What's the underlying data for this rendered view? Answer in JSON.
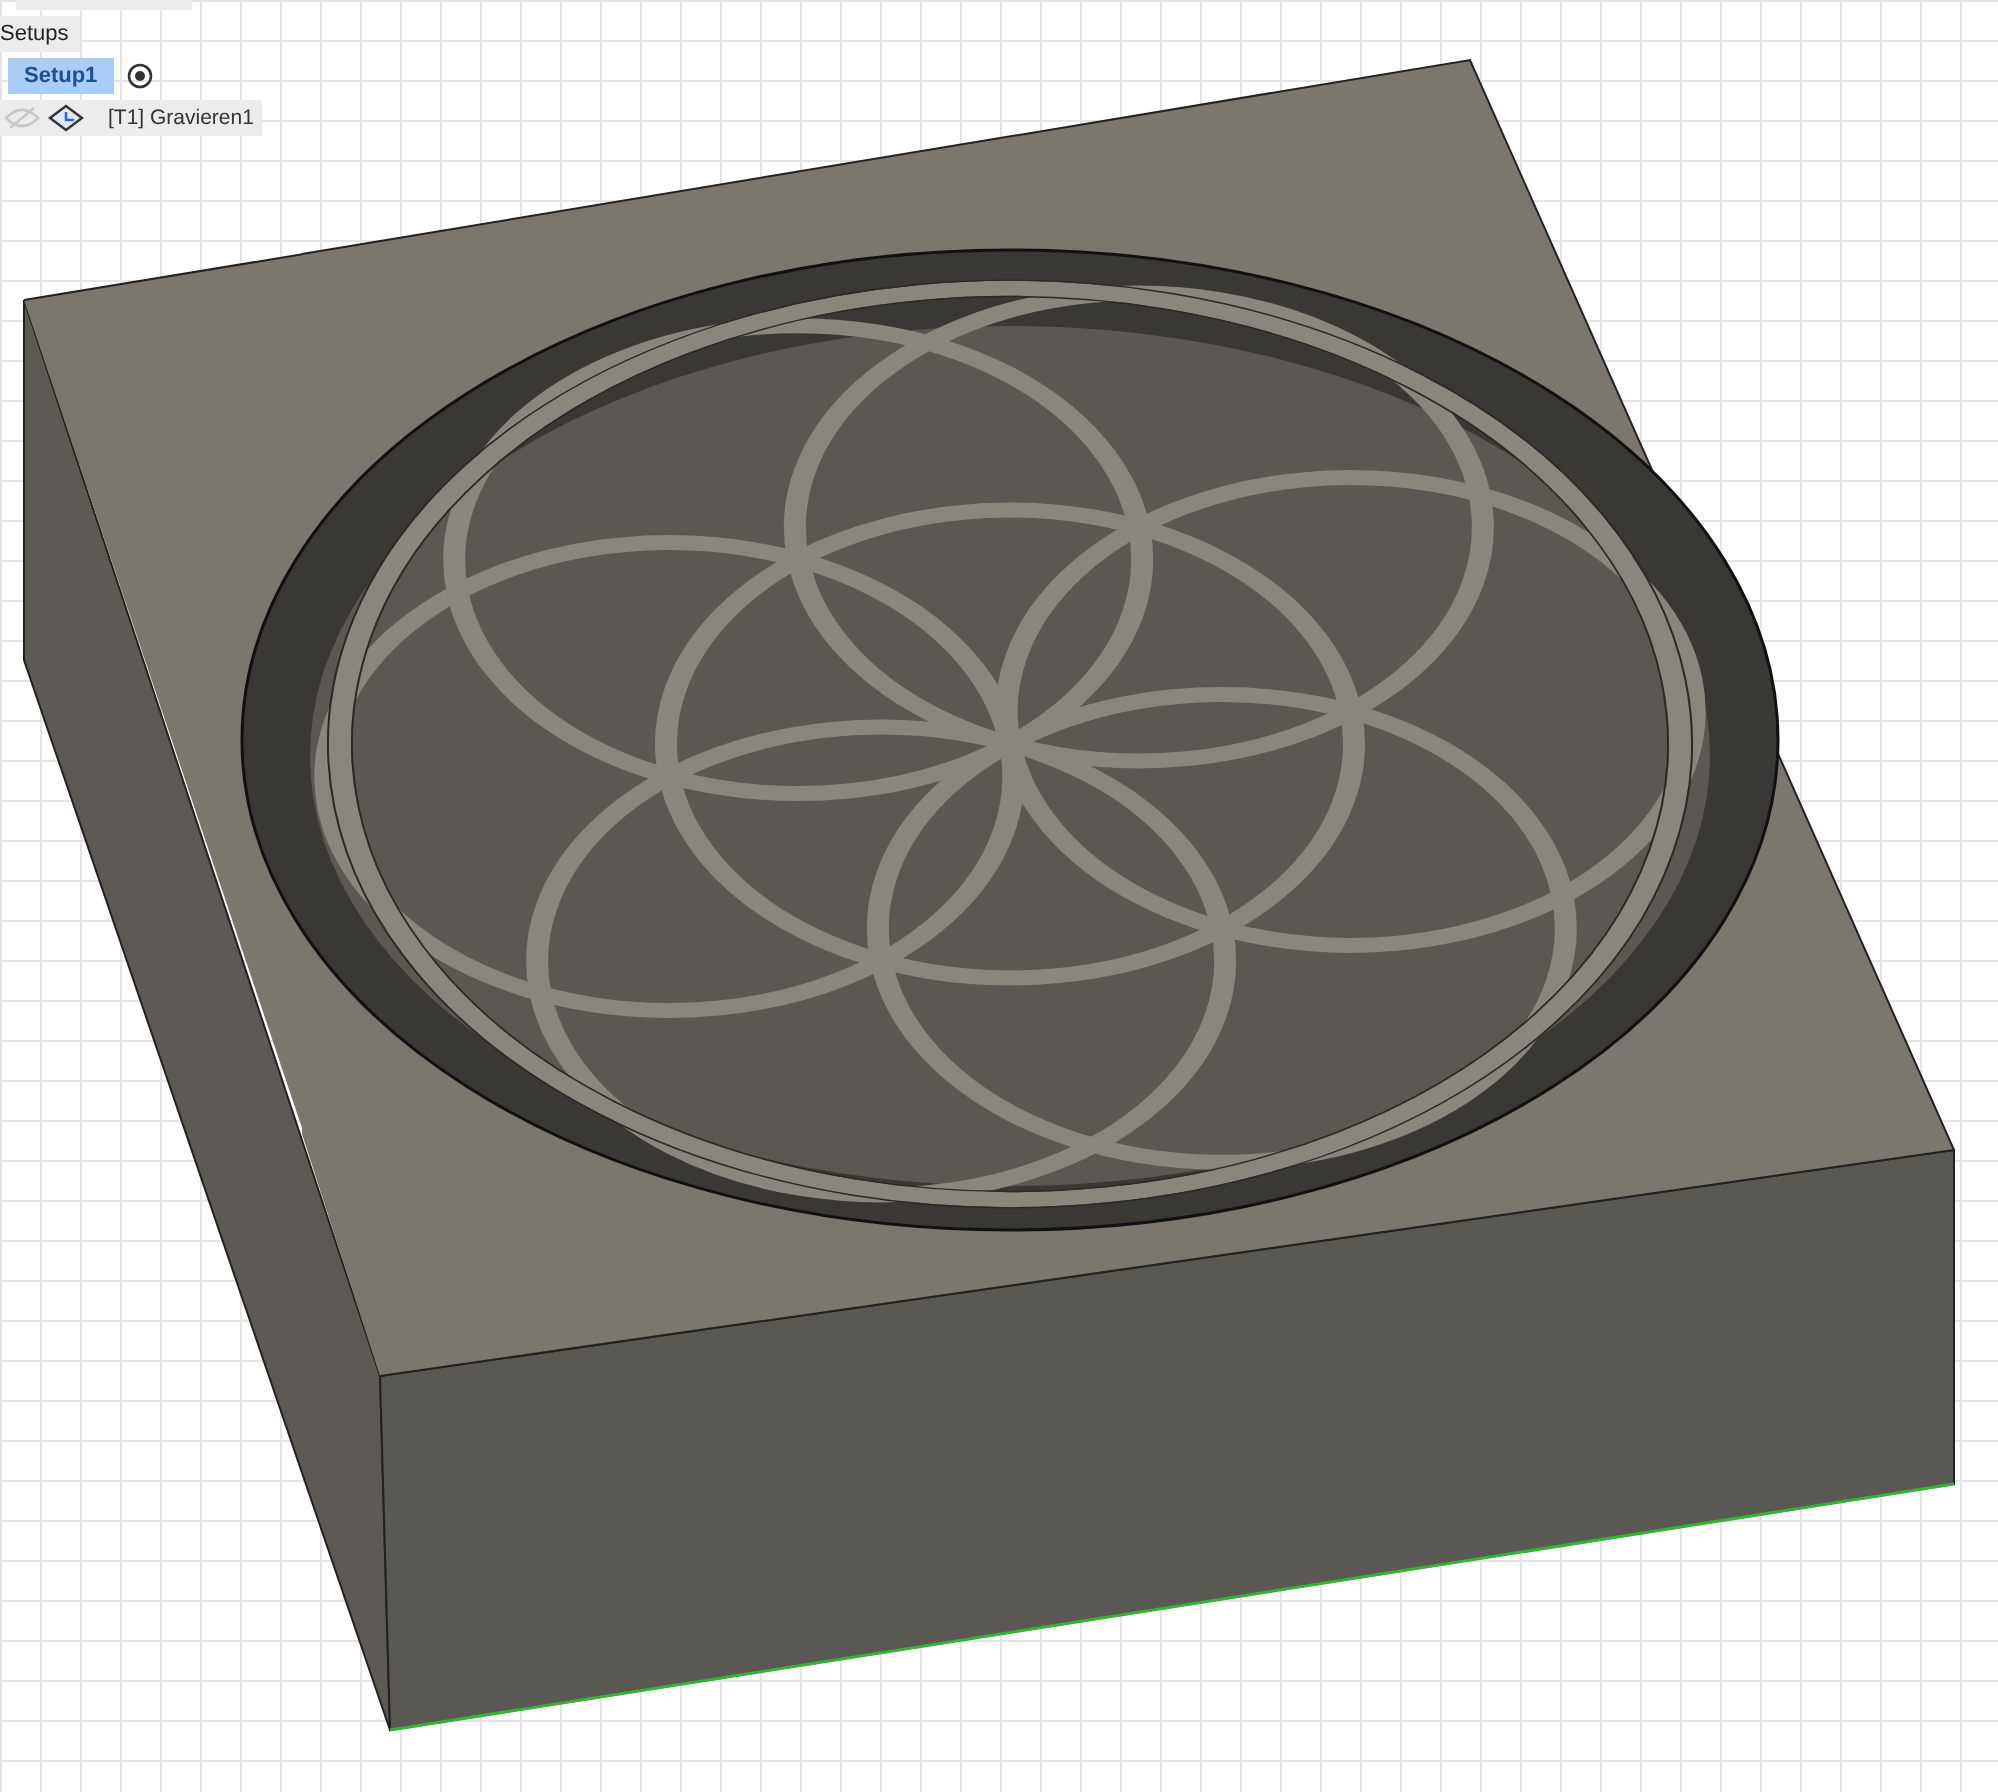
{
  "browser": {
    "folder": "Setups",
    "setups": [
      {
        "label": "Setup1",
        "selected": true
      }
    ],
    "operations": [
      {
        "label": "[T1] Gravieren1"
      }
    ]
  }
}
